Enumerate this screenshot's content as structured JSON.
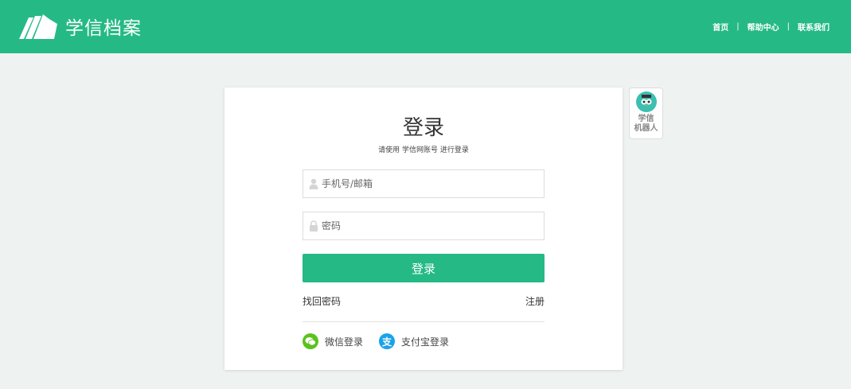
{
  "header": {
    "brand_name": "学信档案",
    "nav": [
      {
        "label": "首页"
      },
      {
        "label": "帮助中心"
      },
      {
        "label": "联系我们"
      }
    ],
    "separator": "|",
    "bg_color": "#25b986"
  },
  "login": {
    "title": "登录",
    "subtitle": "请使用 学信网账号 进行登录",
    "username_placeholder": "手机号/邮箱",
    "password_placeholder": "密码",
    "submit_label": "登录",
    "forgot_label": "找回密码",
    "register_label": "注册",
    "social": {
      "wechat_label": "微信登录",
      "alipay_label": "支付宝登录",
      "alipay_glyph": "支"
    }
  },
  "robot": {
    "line1": "学信",
    "line2": "机器人"
  },
  "icons": {
    "logo": "book-pages-logo-icon",
    "user": "user-icon",
    "lock": "lock-icon",
    "wechat": "wechat-icon",
    "alipay": "alipay-icon",
    "robot": "robot-owl-icon"
  }
}
